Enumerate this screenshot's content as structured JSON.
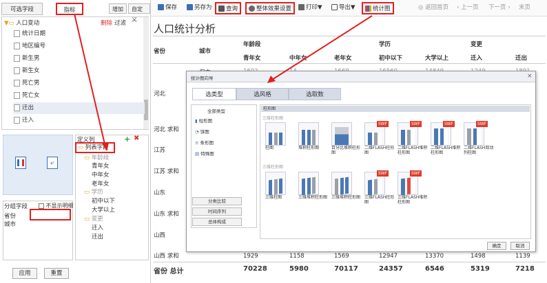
{
  "left": {
    "tabs": [
      "可选字段",
      "指标"
    ],
    "buttons": [
      "增加",
      "自定义"
    ],
    "tree_root": "人口变动",
    "delete_label": "删除",
    "filter_label": "过滤",
    "tree_items": [
      "统计日期",
      "地区编号",
      "新生男",
      "新生女",
      "死亡男",
      "死亡女",
      "迁出",
      "迁入"
    ],
    "define_col_title": "定义列",
    "column_fields_label": "列表字段",
    "define_items": [
      "年龄段",
      "青年女",
      "中年女",
      "老年女",
      "学历",
      "初中以下",
      "大学以上",
      "变更",
      "迁入",
      "迁出"
    ],
    "group_title": "分组字段",
    "hide_detail_label": "不显示明细",
    "group_items": [
      "省份",
      "城市"
    ],
    "apply_label": "应用",
    "reset_label": "重置"
  },
  "toolbar": {
    "items": [
      "保存",
      "另存为",
      "查询",
      "整体效果设置",
      "打印▼",
      "导出▼",
      "统计图"
    ],
    "nav": [
      "返回首页",
      "上一页",
      "下一页",
      "末页"
    ]
  },
  "report": {
    "title": "人口统计分析",
    "head1": [
      "省份",
      "城市",
      "年龄段",
      "学历",
      "变更"
    ],
    "head2": [
      "青年女",
      "中年女",
      "老年女",
      "初中以下",
      "大学以上",
      "迁入",
      "迁出"
    ],
    "city_label": "保中",
    "first_row": [
      "1602",
      "14",
      "1669",
      "16560",
      "14849",
      "1249",
      "1891"
    ],
    "rows": [
      "河北",
      "河北 求和",
      "江苏",
      "江苏 求和",
      "山东",
      "山东 求和",
      "山西",
      "山西 求和"
    ],
    "last_vals": [
      "1929",
      "1158",
      "1569",
      "12947",
      "13370",
      "1498",
      "1139"
    ],
    "total_label": "省份 总计",
    "totals": [
      "70228",
      "5980",
      "70117",
      "24357",
      "6546",
      "5319",
      "7218"
    ]
  },
  "dialog": {
    "title": "统计图向导",
    "tabs": [
      "选类型",
      "选风格",
      "选取数"
    ],
    "type_title": "全部类型",
    "types": [
      "柱形图",
      "饼图",
      "条形图",
      "特殊图"
    ],
    "side_buttons": [
      "分类比较",
      "时间序列",
      "总体构成"
    ],
    "section1": "柱形图",
    "sub1": "三维柱形图",
    "caps1": [
      "柱图",
      "堆积柱形图",
      "百分比堆积柱形图",
      "二维FLASH柱形图",
      "二维FLASH堆积柱形图",
      "二维FLASH堆积柱形图",
      "二维FLASH双动列柱图"
    ],
    "sub2": "三维柱形图",
    "caps2": [
      "三维柱图",
      "三维堆积柱形图",
      "三维堆积柱形图",
      "三维FLASH柱形图",
      "三维FLASH堆积柱形图"
    ],
    "swf_label": "SWF",
    "ok_label": "确定",
    "cancel_label": "取消"
  },
  "colors": {
    "accent": "#e02020",
    "chart_blue": "#4a78b5",
    "chart_gray": "#9aa0a8"
  }
}
